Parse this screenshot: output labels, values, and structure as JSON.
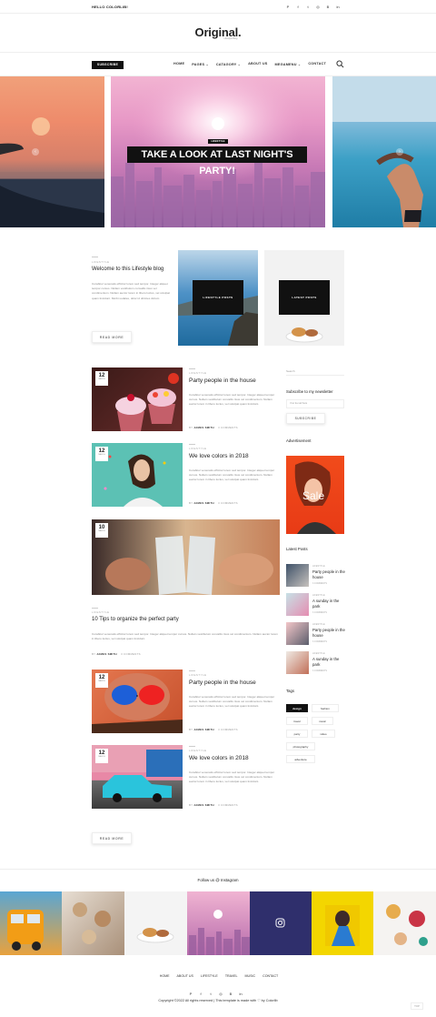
{
  "topbar": {
    "greeting": "HELLO COLORLIB!",
    "social_icons": [
      "pinterest-icon",
      "facebook-icon",
      "twitter-icon",
      "dribbble-icon",
      "behance-icon",
      "linkedin-icon"
    ]
  },
  "brand": {
    "logo": "Original.",
    "tagline": "Lifestyle Blog"
  },
  "nav": {
    "subscribe_label": "SUBSCRIBE",
    "items": [
      "HOME",
      "PAGES",
      "CATAGORY",
      "ABOUT US",
      "MEGAMENU",
      "CONTACT"
    ]
  },
  "hero": {
    "tag": "LIFESTYLE",
    "title": "TAKE A LOOK AT LAST NIGHT'S PARTY!"
  },
  "welcome": {
    "kicker": "LIFESTYLE",
    "title": "Welcome to this Lifestyle blog",
    "body": "Curabitur venenatis efficitur lorem sed tempor. Integer aliquet tempor cursus. Nullam vestibulum convallis risus vel condimentum. Nullam auctor lorem in libero luctus, vel volutpat quam tincidunt. Morbi sodales, dolor id ultricies dictum",
    "button": "READ MORE",
    "card1": "LIFESTYLE POSTS",
    "card2": "LATEST POSTS"
  },
  "posts": [
    {
      "day": "12",
      "month": "MARCH",
      "kicker": "LIFESTYLE",
      "title": "Party people in the house",
      "body": "Curabitur venenatis efficitur lorem sed tempor. Integer aliquet tempor cursus. Nullam vestibulum convallis risus vel condimentum. Nullam auctor lorem in libero luctus, vel volutpat quam tincidunt.",
      "author": "JAMES SMITH",
      "comments": "3 COMMENTS"
    },
    {
      "day": "12",
      "month": "MARCH",
      "kicker": "LIFESTYLE",
      "title": "We love colors in 2018",
      "body": "Curabitur venenatis efficitur lorem sed tempor. Integer aliquet tempor cursus. Nullam vestibulum convallis risus vel condimentum. Nullam auctor lorem in libero luctus, vel volutpat quam tincidunt.",
      "author": "JAMES SMITH",
      "comments": "3 COMMENTS"
    },
    {
      "day": "10",
      "month": "MARCH",
      "kicker": "LIFESTYLE",
      "title": "10 Tips to organize the perfect party",
      "body": "Curabitur venenatis efficitur lorem sed tempor. Integer aliquet tempor cursus. Nullam vestibulum convallis risus vel condimentum. Nullam auctor lorem in libero luctus, vel volutpat quam tincidunt.",
      "author": "JAMES SMITH",
      "comments": "3 COMMENTS"
    },
    {
      "day": "12",
      "month": "MARCH",
      "kicker": "LIFESTYLE",
      "title": "Party people in the house",
      "body": "Curabitur venenatis efficitur lorem sed tempor. Integer aliquet tempor cursus. Nullam vestibulum convallis risus vel condimentum. Nullam auctor lorem in libero luctus, vel volutpat quam tincidunt.",
      "author": "JAMES SMITH",
      "comments": "3 COMMENTS"
    },
    {
      "day": "12",
      "month": "MARCH",
      "kicker": "LIFESTYLE",
      "title": "We love colors in 2018",
      "body": "Curabitur venenatis efficitur lorem sed tempor. Integer aliquet tempor cursus. Nullam vestibulum convallis risus vel condimentum. Nullam auctor lorem in libero luctus, vel volutpat quam tincidunt.",
      "author": "JAMES SMITH",
      "comments": "3 COMMENTS"
    }
  ],
  "by_label": "BY",
  "load_more": "READ MORE",
  "sidebar": {
    "search_placeholder": "Search",
    "newsletter_title": "Subscribe to my newsletter",
    "email_placeholder": "Your E-mail here",
    "subscribe_button": "SUBSCRIBE",
    "ad_title": "Advertisement",
    "ad_text": "Sale",
    "latest_title": "Latest Posts",
    "latest": [
      {
        "kicker": "LIFESTYLE",
        "title": "Party people in the house",
        "date": "3 COMMENTS"
      },
      {
        "kicker": "LIFESTYLE",
        "title": "A sunday in the park",
        "date": "3 COMMENTS"
      },
      {
        "kicker": "LIFESTYLE",
        "title": "Party people in the house",
        "date": "3 COMMENTS"
      },
      {
        "kicker": "LIFESTYLE",
        "title": "A sunday in the park",
        "date": "3 COMMENTS"
      }
    ],
    "tags_title": "Tags",
    "tags": [
      "design",
      "fashion",
      "travel",
      "music",
      "party",
      "video",
      "photography",
      "adventure"
    ]
  },
  "instagram": {
    "title": "Follow us @ Instagram"
  },
  "footer": {
    "nav": [
      "HOME",
      "ABOUT US",
      "LIFESTYLE",
      "TRAVEL",
      "MUSIC",
      "CONTACT"
    ],
    "copyright": "Copyright ©2022 All rights reserved | This template is made with ♡ by Colorlib",
    "back_to_top": "TOP"
  }
}
